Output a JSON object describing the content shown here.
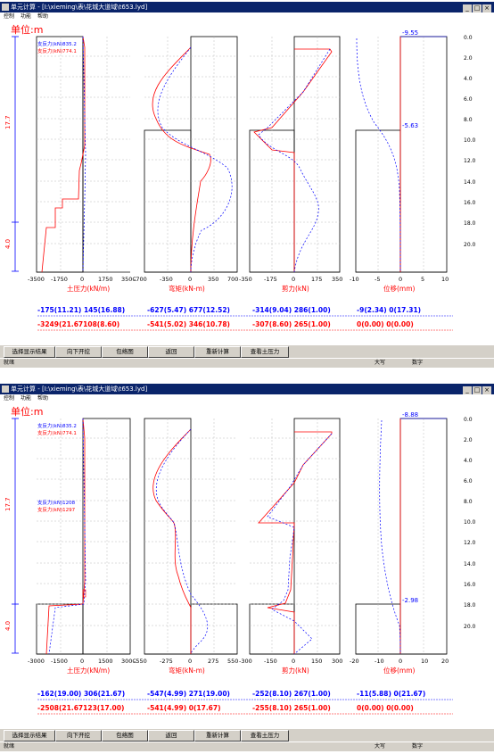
{
  "window1": {
    "title": "单元计算 - [I:\\xieming\\表\\花城大道域\\t653.lyd]",
    "menu": [
      "控制",
      "功能",
      "帮助"
    ],
    "unit_label": "单位:m",
    "support_labels": [
      "支反力(kN)835.2",
      "支反力(kN)774.1"
    ],
    "dim_labels": [
      "17.7",
      "4.0"
    ],
    "depth_ticks": [
      "0.0",
      "2.0",
      "4.0",
      "6.0",
      "8.0",
      "10.0",
      "12.0",
      "14.0",
      "16.0",
      "18.0",
      "20.0"
    ],
    "axis_ticks": {
      "soil": [
        "-3500",
        "-1750",
        "0",
        "1750",
        "350C"
      ],
      "moment": [
        "-700",
        "-350",
        "0",
        "350",
        "700"
      ],
      "shear": [
        "-350",
        "-175",
        "0",
        "175",
        "350"
      ],
      "disp": [
        "-10",
        "-5",
        "0",
        "5",
        "10"
      ]
    },
    "axis_titles": [
      "土压力(kN/m)",
      "弯矩(kN-m)",
      "剪力(kN)",
      "位移(mm)"
    ],
    "disp_top": "-9.55",
    "disp_mid": "-5.63",
    "results_row1": [
      "-175(11.21) 145(16.88)",
      "-627(5.47)  677(12.52)",
      "-314(9.04)  286(1.00)",
      "-9(2.34)     0(17.31)"
    ],
    "results_row2": [
      "-3249(21.67108(8.60)",
      "-541(5.02)  346(10.78)",
      "-307(8.60)  265(1.00)",
      "0(0.00)     0(0.00)"
    ]
  },
  "window2": {
    "title": "单元计算 - [I:\\xieming\\表\\花城大道域\\t653.lyd]",
    "menu": [
      "控制",
      "功能",
      "帮助"
    ],
    "unit_label": "单位:m",
    "support_labels": [
      "支反力(kN)835.2",
      "支反力(kN)774.1",
      "支反力(kN)1208",
      "支反力(kN)1297"
    ],
    "dim_labels": [
      "17.7",
      "4.0"
    ],
    "depth_ticks": [
      "0.0",
      "2.0",
      "4.0",
      "6.0",
      "8.0",
      "10.0",
      "12.0",
      "14.0",
      "16.0",
      "18.0",
      "20.0"
    ],
    "axis_ticks": {
      "soil": [
        "-3000",
        "-1500",
        "0",
        "1500",
        "300C"
      ],
      "moment": [
        "-550",
        "-275",
        "0",
        "275",
        "550"
      ],
      "shear": [
        "-300",
        "-150",
        "0",
        "150",
        "300"
      ],
      "disp": [
        "-20",
        "-10",
        "0",
        "10",
        "20"
      ]
    },
    "axis_titles": [
      "土压力(kN/m)",
      "弯矩(kN-m)",
      "剪力(kN)",
      "位移(mm)"
    ],
    "disp_top": "-8.88",
    "disp_mid": "-2.98",
    "results_row1": [
      "-162(19.00) 306(21.67)",
      "-547(4.99)  271(19.00)",
      "-252(8.10)  267(1.00)",
      "-11(5.88)    0(21.67)"
    ],
    "results_row2": [
      "-2508(21.67123(17.00)",
      "-541(4.99)  0(17.67)",
      "-255(8.10)  265(1.00)",
      "0(0.00)     0(0.00)"
    ]
  },
  "buttons": [
    "选择显示结果",
    "向下开挖",
    "包络图",
    "返回",
    "重新计算",
    "查看土压力"
  ],
  "status": {
    "left": "就绪",
    "caps": "大写",
    "num": "数字"
  },
  "colors": {
    "title_bg": "#0a246a",
    "red": "#ff0000",
    "blue": "#0000ff",
    "face": "#d4d0c8"
  }
}
